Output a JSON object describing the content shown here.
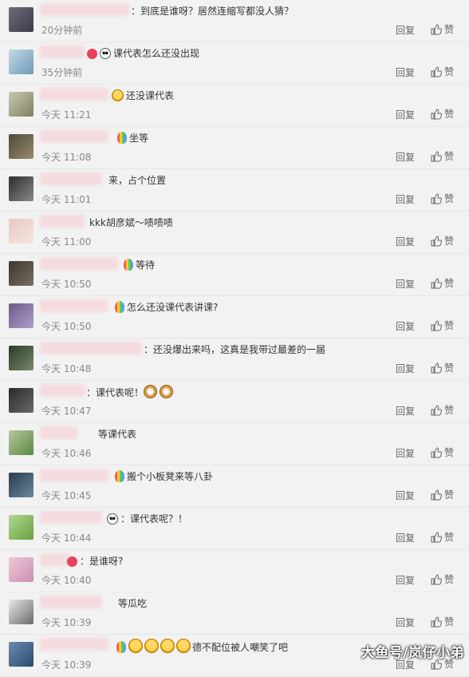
{
  "comments": [
    {
      "text": "：到底是谁呀？居然连缩写都没人猜？",
      "time": "20分钟前",
      "name_w": 112,
      "text_x": 164,
      "emojis": [],
      "avatar": [
        "#6d6d7a",
        "#3a3a48"
      ]
    },
    {
      "text": "课代表怎么还没出现",
      "time": "35分钟前",
      "name_w": 56,
      "text_x": 145,
      "emojis": [
        {
          "icon": "red-ribbon-icon",
          "cls": "heart",
          "color": "#e33"
        },
        {
          "icon": "panda-emoji-icon",
          "cls": "panda"
        }
      ],
      "avatar": [
        "#c4d8e6",
        "#6f9bb5"
      ]
    },
    {
      "text": "还没课代表",
      "time": "今天 11:21",
      "name_w": 86,
      "text_x": 158,
      "emojis": [
        {
          "icon": "smile-emoji-icon",
          "cls": "face"
        }
      ],
      "avatar": [
        "#c9c9b0",
        "#7f8062"
      ]
    },
    {
      "text": "坐等",
      "time": "今天 11:08",
      "name_w": 86,
      "text_x": 165,
      "emojis": [
        {
          "icon": "rainbow-bulb-icon",
          "cls": "bulb"
        }
      ],
      "avatar": [
        "#4a4a3a",
        "#9b8a6f"
      ]
    },
    {
      "text": "来，占个位置",
      "time": "今天 11:01",
      "name_w": 78,
      "text_x": 136,
      "emojis": [],
      "avatar": [
        "#2c2c2c",
        "#8a8a8a"
      ]
    },
    {
      "text": "kkk胡彦斌～啧啧啧",
      "time": "今天 11:00",
      "name_w": 56,
      "text_x": 112,
      "emojis": [],
      "avatar": [
        "#e8c9c2",
        "#f5e6e0"
      ]
    },
    {
      "text": "等待",
      "time": "今天 10:50",
      "name_w": 98,
      "text_x": 173,
      "emojis": [
        {
          "icon": "rainbow-bulb-icon",
          "cls": "bulb"
        }
      ],
      "avatar": [
        "#3a3630",
        "#7a7060"
      ]
    },
    {
      "text": "怎么还没课代表讲课?",
      "time": "今天 10:50",
      "name_w": 86,
      "text_x": 162,
      "emojis": [
        {
          "icon": "rainbow-bulb-icon",
          "cls": "bulb"
        }
      ],
      "avatar": [
        "#6a5a8a",
        "#b0a0c8"
      ]
    },
    {
      "text": "：还没爆出来吗，这真是我带过最差的一届",
      "time": "今天 10:48",
      "name_w": 128,
      "text_x": 180,
      "emojis": [],
      "avatar": [
        "#2a3a2a",
        "#7a8a6a"
      ]
    },
    {
      "text": "：课代表呢！",
      "time": "今天 10:47",
      "name_w": 56,
      "text_x": 108,
      "emojis": [],
      "trail": [
        {
          "icon": "cat-emoji-icon",
          "cls": "cat"
        },
        {
          "icon": "cat-emoji-icon",
          "cls": "cat"
        }
      ],
      "avatar": [
        "#2a2a2a",
        "#6a6a6a"
      ]
    },
    {
      "text": "等课代表",
      "time": "今天 10:46",
      "name_w": 48,
      "text_x": 123,
      "emojis": [],
      "avatar": [
        "#b8c8a0",
        "#5a8a40"
      ]
    },
    {
      "text": "搬个小板凳来等八卦",
      "time": "今天 10:45",
      "name_w": 86,
      "text_x": 162,
      "emojis": [
        {
          "icon": "rainbow-bulb-icon",
          "cls": "bulb"
        }
      ],
      "avatar": [
        "#2a3a4a",
        "#6a8aa0"
      ]
    },
    {
      "text": "：课代表呢？！",
      "time": "今天 10:44",
      "name_w": 78,
      "text_x": 152,
      "emojis": [
        {
          "icon": "panda-emoji-icon",
          "cls": "panda"
        }
      ],
      "avatar": [
        "#b0d890",
        "#6aa040"
      ]
    },
    {
      "text": "：是谁呀?",
      "time": "今天 10:40",
      "name_w": 38,
      "text_x": 102,
      "emojis": [
        {
          "icon": "heart-icon",
          "cls": "heart"
        }
      ],
      "avatar": [
        "#f0c8d8",
        "#c890b0"
      ]
    },
    {
      "text": "等瓜吃",
      "time": "今天 10:39",
      "name_w": 78,
      "text_x": 148,
      "emojis": [],
      "avatar": [
        "#e8e8e8",
        "#6a6a6a"
      ]
    },
    {
      "text": "德不配位被人嘲笑了吧",
      "time": "今天 10:39",
      "name_w": 86,
      "text_x": 236,
      "emojis": [
        {
          "icon": "rainbow-bulb-icon",
          "cls": "bulb"
        },
        {
          "icon": "laugh-emoji-icon",
          "cls": "face big"
        },
        {
          "icon": "laugh-emoji-icon",
          "cls": "face big"
        },
        {
          "icon": "laugh-emoji-icon",
          "cls": "face big"
        },
        {
          "icon": "laugh-emoji-icon",
          "cls": "face big"
        }
      ],
      "avatar": [
        "#6a8ab0",
        "#2a4a70"
      ]
    }
  ],
  "reply_label": "回复",
  "like_label": "赞",
  "watermark": "大鱼号/岚仔小弟"
}
